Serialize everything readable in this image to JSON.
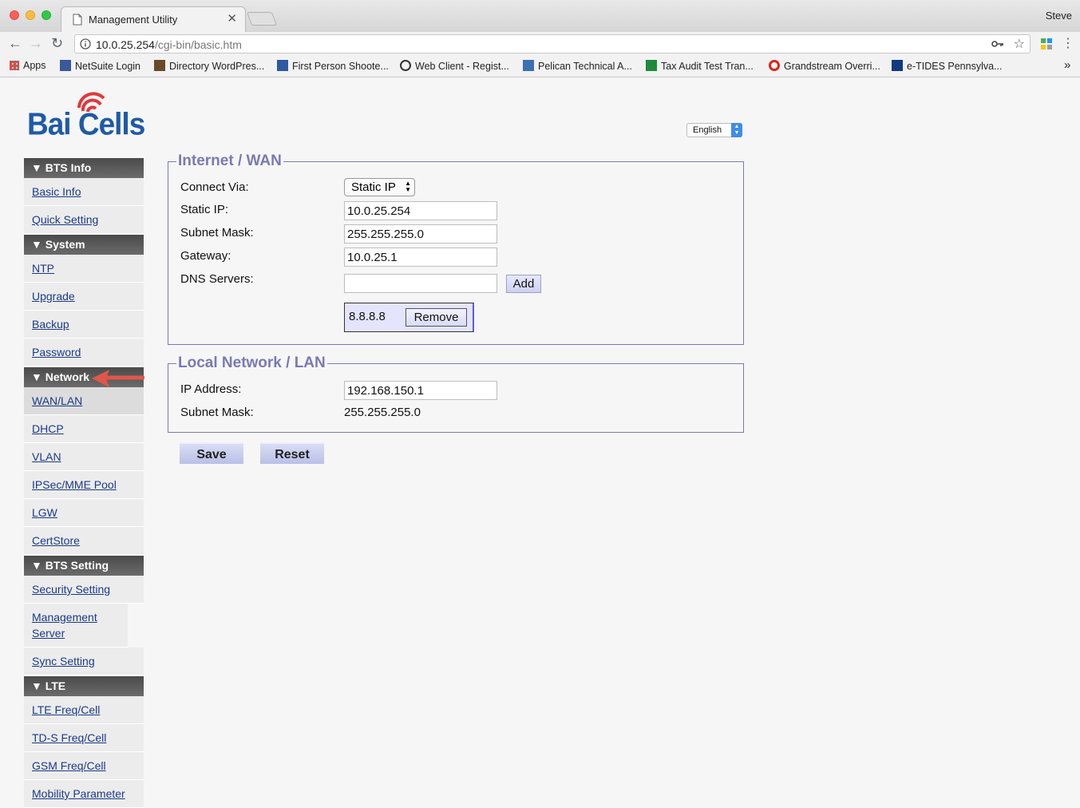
{
  "browser": {
    "tab_title": "Management Utility",
    "profile": "Steve",
    "url_host": "10.0.25.254",
    "url_path": "/cgi-bin/basic.htm",
    "bookmarks": [
      "Apps",
      "NetSuite Login",
      "Directory WordPres...",
      "First Person Shoote...",
      "Web Client - Regist...",
      "Pelican Technical A...",
      "Tax Audit Test Tran...",
      "Grandstream Overri...",
      "e-TIDES Pennsylva..."
    ],
    "more": "»"
  },
  "logo": {
    "text": "Bai Cells"
  },
  "language": {
    "selected": "English"
  },
  "sidebar": {
    "bts_info": "▼ BTS Info",
    "basic_info": "Basic Info",
    "quick_setting": "Quick Setting",
    "system": "▼ System",
    "ntp": "NTP",
    "upgrade": "Upgrade",
    "backup": "Backup",
    "password": "Password",
    "network": "▼ Network",
    "wanlan": "WAN/LAN",
    "dhcp": "DHCP",
    "vlan": "VLAN",
    "ipsec": "IPSec/MME Pool",
    "lgw": "LGW",
    "certstore": "CertStore",
    "bts_setting": "▼ BTS Setting",
    "security_setting": "Security Setting",
    "management_server": "Management Server",
    "sync_setting": "Sync Setting",
    "lte": "▼ LTE",
    "lte_freq": "LTE Freq/Cell",
    "tds_freq": "TD-S Freq/Cell",
    "gsm_freq": "GSM Freq/Cell",
    "mobility": "Mobility Parameter"
  },
  "wan": {
    "legend": "Internet / WAN",
    "connect_via_label": "Connect Via:",
    "connect_via_value": "Static IP",
    "static_ip_label": "Static IP:",
    "static_ip": "10.0.25.254",
    "subnet_label": "Subnet Mask:",
    "subnet": "255.255.255.0",
    "gateway_label": "Gateway:",
    "gateway": "10.0.25.1",
    "dns_label": "DNS Servers:",
    "dns_input": "",
    "add_label": "Add",
    "dns_entry": "8.8.8.8",
    "remove_label": "Remove"
  },
  "lan": {
    "legend": "Local Network / LAN",
    "ip_label": "IP Address:",
    "ip": "192.168.150.1",
    "subnet_label": "Subnet Mask:",
    "subnet": "255.255.255.0"
  },
  "actions": {
    "save": "Save",
    "reset": "Reset"
  }
}
